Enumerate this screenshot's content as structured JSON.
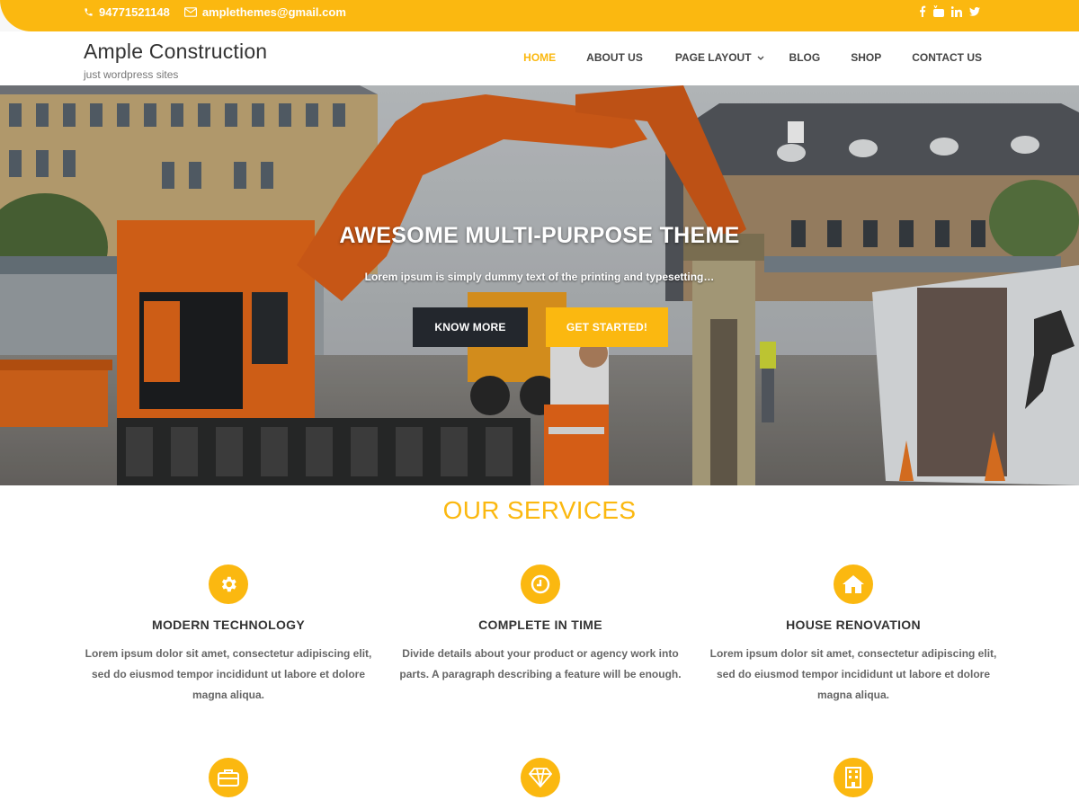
{
  "topbar": {
    "phone": "94771521148",
    "email": "amplethemes@gmail.com",
    "social": [
      "facebook-icon",
      "youtube-icon",
      "linkedin-icon",
      "twitter-icon"
    ]
  },
  "header": {
    "site_title": "Ample Construction",
    "tagline": "just wordpress sites"
  },
  "nav": {
    "items": [
      {
        "label": "HOME",
        "active": true
      },
      {
        "label": "ABOUT US"
      },
      {
        "label": "PAGE LAYOUT",
        "has_dropdown": true
      },
      {
        "label": "BLOG"
      },
      {
        "label": "SHOP"
      },
      {
        "label": "CONTACT US"
      }
    ]
  },
  "hero": {
    "title": "AWESOME MULTI-PURPOSE THEME",
    "subtitle": "Lorem ipsum is simply dummy text of the printing and typesetting…",
    "btn_know": "KNOW MORE",
    "btn_start": "GET STARTED!"
  },
  "services": {
    "heading": "OUR SERVICES",
    "items": [
      {
        "icon": "gear-icon",
        "title": "MODERN TECHNOLOGY",
        "desc": "Lorem ipsum dolor sit amet, consectetur adipiscing elit, sed do eiusmod tempor incididunt ut labore et dolore magna aliqua."
      },
      {
        "icon": "clock-icon",
        "title": "COMPLETE IN TIME",
        "desc": "Divide details about your product or agency work into parts. A paragraph describing a feature will be enough."
      },
      {
        "icon": "home-icon",
        "title": "HOUSE RENOVATION",
        "desc": "Lorem ipsum dolor sit amet, consectetur adipiscing elit, sed do eiusmod tempor incididunt ut labore et dolore magna aliqua."
      },
      {
        "icon": "briefcase-icon"
      },
      {
        "icon": "diamond-icon"
      },
      {
        "icon": "building-icon"
      }
    ]
  },
  "colors": {
    "accent": "#fbb810",
    "dark_button": "#23272d"
  }
}
